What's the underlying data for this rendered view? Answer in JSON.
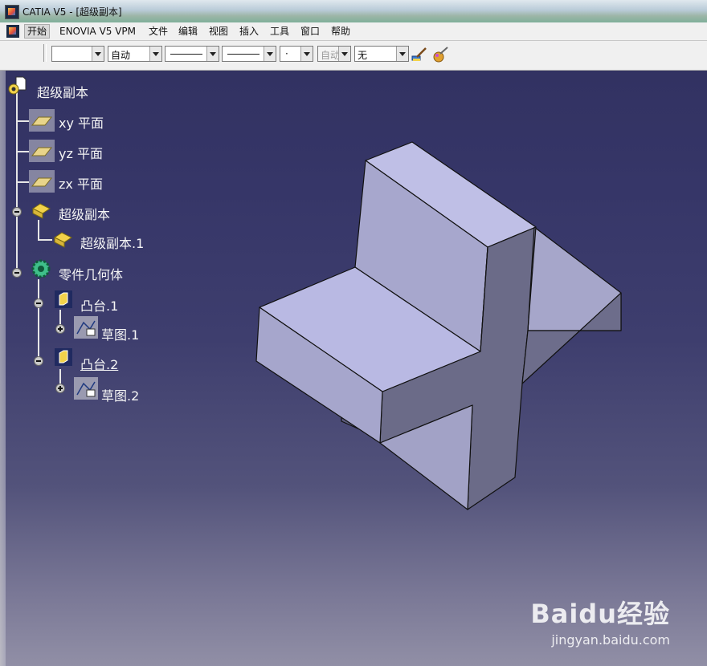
{
  "window": {
    "title": "CATIA V5 - [超级副本]"
  },
  "menubar": {
    "items": [
      "开始",
      "ENOVIA V5 VPM",
      "文件",
      "编辑",
      "视图",
      "插入",
      "工具",
      "窗口",
      "帮助"
    ],
    "active_index": 0
  },
  "toolbar": {
    "color_value": "",
    "transparency_value": "自动",
    "line_thickness_value": "",
    "line_type_value": "",
    "point_type_value": "·",
    "layer_value": "自动",
    "rendering_value": "无"
  },
  "tree": {
    "root": "超级副本",
    "planes": [
      "xy 平面",
      "yz 平面",
      "zx 平面"
    ],
    "powercopy_group": "超级副本",
    "powercopy_item": "超级副本.1",
    "body": "零件几何体",
    "pad1": "凸台.1",
    "sketch1": "草图.1",
    "pad2": "凸台.2",
    "sketch2": "草图.2"
  },
  "watermark": {
    "brand": "Baidu经验",
    "url": "jingyan.baidu.com"
  },
  "colors": {
    "background_top": "#323262",
    "background_bottom": "#918fa6",
    "part_face": "#b4b4d9",
    "part_shade": "#676783"
  }
}
